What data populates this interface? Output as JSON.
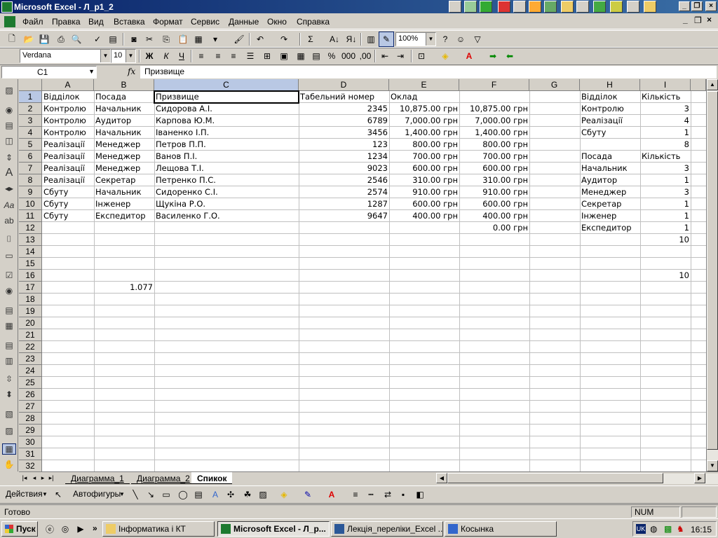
{
  "window": {
    "title": "Microsoft Excel - Л_р1_2"
  },
  "menu": [
    "Файл",
    "Правка",
    "Вид",
    "Вставка",
    "Формат",
    "Сервис",
    "Данные",
    "Окно",
    "Справка"
  ],
  "toolbar": {
    "zoom": "100%",
    "font_name": "Verdana",
    "font_size": "10"
  },
  "formula_bar": {
    "name_box": "C1",
    "fx": "fx",
    "content": "Призвище"
  },
  "columns": [
    "A",
    "B",
    "C",
    "D",
    "E",
    "F",
    "G",
    "H",
    "I"
  ],
  "rows": [
    "1",
    "2",
    "3",
    "4",
    "5",
    "6",
    "7",
    "8",
    "9",
    "10",
    "11",
    "12",
    "13",
    "14",
    "15",
    "16",
    "17",
    "18",
    "19",
    "20",
    "21",
    "22",
    "23",
    "24",
    "25",
    "26",
    "27",
    "28",
    "29",
    "30",
    "31",
    "32"
  ],
  "cells": {
    "header": {
      "a": "Відділок",
      "b": "Посада",
      "c": "Призвище",
      "d": "Табельний номер",
      "e": "Оклад",
      "h": "Відділок",
      "i": "Кількість"
    },
    "data": [
      {
        "a": "Контролю",
        "b": "Начальник",
        "c": "Сидорова А.І.",
        "d": "2345",
        "e": "10,875.00 грн",
        "f": "10,875.00 грн",
        "h": "Контролю",
        "i": "3"
      },
      {
        "a": "Контролю",
        "b": "Аудитор",
        "c": "Карпова Ю.М.",
        "d": "6789",
        "e": "7,000.00 грн",
        "f": "7,000.00 грн",
        "h": "Реалізації",
        "i": "4"
      },
      {
        "a": "Контролю",
        "b": "Начальник",
        "c": "Іваненко І.П.",
        "d": "3456",
        "e": "1,400.00 грн",
        "f": "1,400.00 грн",
        "h": "Сбуту",
        "i": "1"
      },
      {
        "a": "Реалізації",
        "b": "Менеджер",
        "c": "Петров П.П.",
        "d": "123",
        "e": "800.00 грн",
        "f": "800.00 грн",
        "h": "",
        "i": "8"
      },
      {
        "a": "Реалізації",
        "b": "Менеджер",
        "c": "Ванов П.І.",
        "d": "1234",
        "e": "700.00 грн",
        "f": "700.00 грн",
        "h": "Посада",
        "i": "Кількість"
      },
      {
        "a": "Реалізації",
        "b": "Менеджер",
        "c": "Лещова Т.І.",
        "d": "9023",
        "e": "600.00 грн",
        "f": "600.00 грн",
        "h": "Начальник",
        "i": "3"
      },
      {
        "a": "Реалізації",
        "b": "Секретар",
        "c": "Петренко П.С.",
        "d": "2546",
        "e": "310.00 грн",
        "f": "310.00 грн",
        "h": "Аудитор",
        "i": "1"
      },
      {
        "a": "Сбуту",
        "b": "Начальник",
        "c": "Сидоренко С.І.",
        "d": "2574",
        "e": "910.00 грн",
        "f": "910.00 грн",
        "h": "Менеджер",
        "i": "3"
      },
      {
        "a": "Сбуту",
        "b": "Інженер",
        "c": "Щукіна Р.О.",
        "d": "1287",
        "e": "600.00 грн",
        "f": "600.00 грн",
        "h": "Секретар",
        "i": "1"
      },
      {
        "a": "Сбуту",
        "b": "Експедитор",
        "c": "Василенко Г.О.",
        "d": "9647",
        "e": "400.00 грн",
        "f": "400.00 грн",
        "h": "Інженер",
        "i": "1"
      }
    ],
    "f12": "0.00 грн",
    "h12": "Експедитор",
    "i12": "1",
    "i13": "10",
    "i16": "10",
    "b17": "1.077"
  },
  "sheets": [
    "Диаграмма_1",
    "Диаграмма_2",
    "Спикок"
  ],
  "active_sheet": "Спикок",
  "draw_toolbar": {
    "actions": "Действия",
    "autoshapes": "Автофигуры"
  },
  "status": {
    "text": "Готово",
    "num": "NUM"
  },
  "taskbar": {
    "start": "Пуск",
    "tasks": [
      "Інформатика і КТ",
      "Microsoft Excel - Л_р...",
      "Лекція_переліки_Excel ...",
      "Косынка"
    ],
    "lang": "UK",
    "clock": "16:15"
  },
  "colors": {
    "title_start": "#0a246a",
    "title_end": "#3a6ea5",
    "face": "#d4d0c8",
    "selected_header": "#b9c8e4"
  }
}
